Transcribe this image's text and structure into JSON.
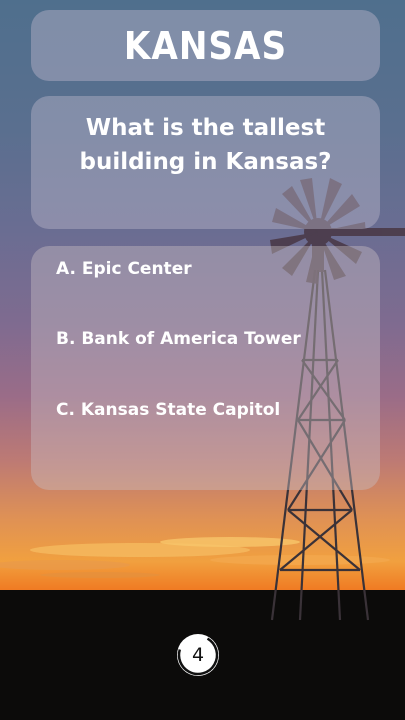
{
  "header": {
    "title": "KANSAS"
  },
  "question": {
    "text": "What is the tallest building in Kansas?"
  },
  "answers": [
    {
      "label": "A. Epic Center"
    },
    {
      "label": "B. Bank of America Tower"
    },
    {
      "label": "C. Kansas State Capitol"
    }
  ],
  "timer": {
    "value": "4"
  }
}
